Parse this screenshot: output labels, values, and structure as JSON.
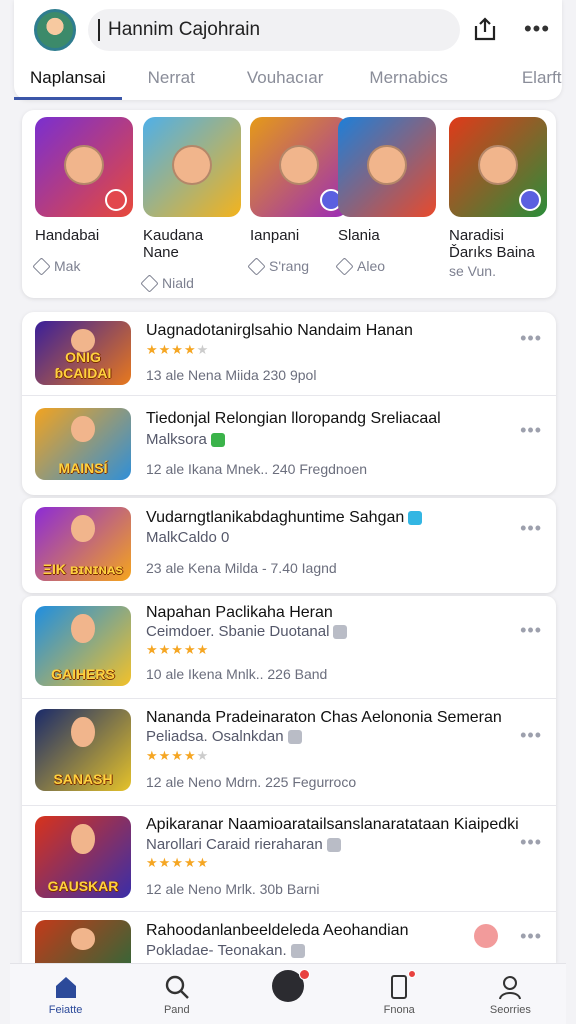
{
  "header": {
    "search_text": "Ηannim Cajohrain",
    "tabs": [
      "Naplansai",
      "Nerrat",
      "Vouhacıar",
      "Mernabics",
      "Elarft"
    ]
  },
  "featured": [
    {
      "name": "Handabai",
      "meta": "Mak",
      "colors": [
        "#7a2fd0",
        "#e8493a"
      ],
      "badge": "red"
    },
    {
      "name": "Kaudana Nane",
      "meta": "Niald",
      "colors": [
        "#4fb0e8",
        "#f3b31d"
      ],
      "badge": "none"
    },
    {
      "name": "Ianpani",
      "meta": "S'rang",
      "colors": [
        "#e59a18",
        "#9b2bb8"
      ],
      "badge": "blue"
    },
    {
      "name": "Slania",
      "meta": "Aleo",
      "colors": [
        "#1e7fd8",
        "#e84a2c"
      ],
      "badge": "none"
    },
    {
      "name": "Naradisi Ďarıks Baina",
      "meta": "se Vun.",
      "colors": [
        "#e03a1a",
        "#2b8d3a"
      ],
      "badge": "blue"
    }
  ],
  "rows": [
    {
      "title": "Uagnadotanirglsahio Nandaim Hanan",
      "sub": "",
      "stars": 3.5,
      "meta": "13  ale Nena   Miida    230    9pol",
      "word": "ONIG ɓCAIDAI",
      "colors": [
        "#3a1f9a",
        "#e8791d"
      ]
    },
    {
      "title": "Tiedonjal Relongian lloropandg Sreliacaal",
      "sub": "Malksora",
      "tag": "#3bb34a",
      "meta": "12  ale Ikana   Mnek..  240   Fregdnoen",
      "word": "MAINSÍ",
      "colors": [
        "#f2a320",
        "#2f8fd8"
      ]
    },
    {
      "title": "Vudarngtlanikabdaghuntime Sahgan",
      "sub": "MalkCaldo 0",
      "tag": "#33b6e3",
      "meta": "23  ale Kena    Milda -  7.40   Iagnd",
      "word": "ΞΙΚ ʙɪɴɪɴᴀs",
      "colors": [
        "#8c2bd6",
        "#f5a51d"
      ]
    },
    {
      "title": "Napahan Paclikaha Heran",
      "sub": "Ceimdoer. Sbanie Duotanal",
      "tag": "#b9bcc6",
      "stars": 5,
      "meta": "10  ale Ikena   Mnlk..  226   Band",
      "word": "GAIHERS",
      "colors": [
        "#1f8ee0",
        "#f2c12a"
      ]
    },
    {
      "title": "Nananda Pradeinaraton Chas Aelononia Semeran",
      "sub": "Peliadsa. Osalnkdan",
      "tag": "#b9bcc6",
      "stars": 3.5,
      "meta": "12  ale Neno    Mdrn.   225   Fegurroco",
      "word": "SANASH",
      "colors": [
        "#1a2a6a",
        "#e5c22a"
      ]
    },
    {
      "title": "Apikaranar Naamioaratailsanslanaratataan Kiaipedki",
      "sub": "Narollari Caraid rieraharan",
      "tag": "#b9bcc6",
      "stars": 5,
      "meta": "12  ale Neno    Mrlk.    30b   Barni",
      "word": "GAUSKAR",
      "colors": [
        "#d8331b",
        "#3a2ea8"
      ]
    },
    {
      "title": "Rahoodanlanbeeldeleda Aeohandian",
      "sub": "Pokladae- Teonakan.",
      "tag": "#b9bcc6",
      "meta": "",
      "word": "",
      "colors": [
        "#c23a1a",
        "#2a6a3a"
      ]
    }
  ],
  "nav": [
    {
      "label": "Feiatte",
      "active": true
    },
    {
      "label": "Pand"
    },
    {
      "label": ""
    },
    {
      "label": "Fnona"
    },
    {
      "label": "Seorries"
    }
  ]
}
